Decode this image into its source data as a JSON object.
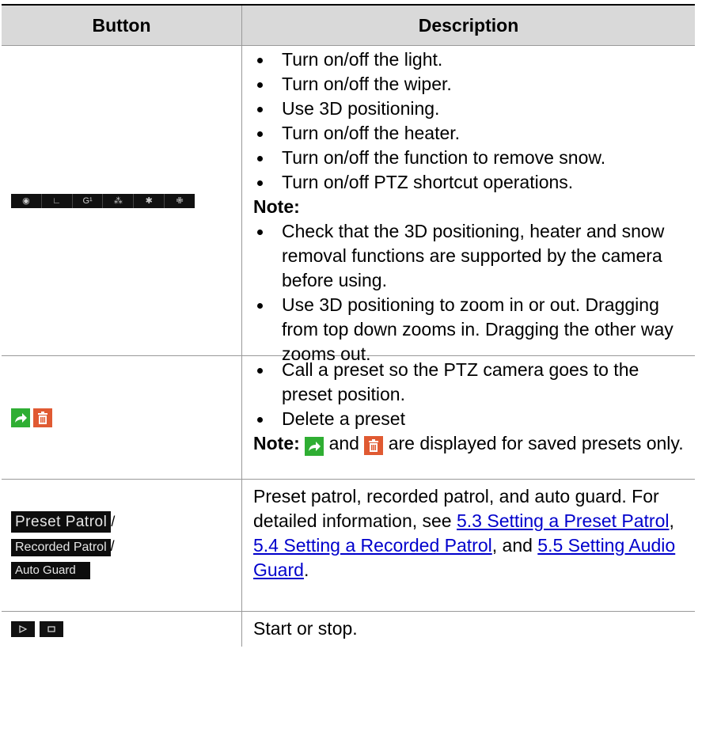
{
  "table": {
    "header": {
      "button": "Button",
      "description": "Description"
    },
    "row1": {
      "icons": [
        "eye-icon",
        "wiper-icon",
        "3d-positioning-icon",
        "heater-icon",
        "snow-removal-icon",
        "shortcut-icon"
      ],
      "items": [
        "Turn on/off the light.",
        "Turn on/off the wiper.",
        "Use 3D positioning.",
        "Turn on/off the heater.",
        "Turn on/off the function to remove snow.",
        "Turn on/off PTZ shortcut operations."
      ],
      "note_label": "Note:",
      "notes": [
        "Check that the 3D positioning, heater and snow removal functions are supported by the camera before using.",
        "Use 3D positioning to zoom in or out. Dragging from top down zooms in. Dragging the other way zooms out."
      ]
    },
    "row2": {
      "items": [
        "Call a preset so the PTZ camera goes to the preset position.",
        "Delete a preset"
      ],
      "note_label": "Note:",
      "note_and": "and",
      "note_rest": "are displayed for saved presets only."
    },
    "row3": {
      "btn_preset_patrol": "Preset Patrol",
      "btn_recorded_patrol": "Recorded Patrol",
      "btn_auto_guard": "Auto Guard",
      "slash": "/",
      "text_1": "Preset patrol, recorded patrol, and auto guard. For detailed information, see",
      "link_1": "5.3 Setting a Preset Patrol",
      "sep_1": ",",
      "link_2": "5.4 Setting a Recorded Patrol",
      "sep_2": ", and",
      "link_3": "5.5 Setting Audio Guard",
      "end": "."
    },
    "row4": {
      "text": "Start or stop."
    }
  },
  "colors": {
    "header_bg": "#d9d9d9",
    "link": "#0000cc",
    "goto_green": "#2fae33",
    "delete_orange": "#e05a32"
  }
}
